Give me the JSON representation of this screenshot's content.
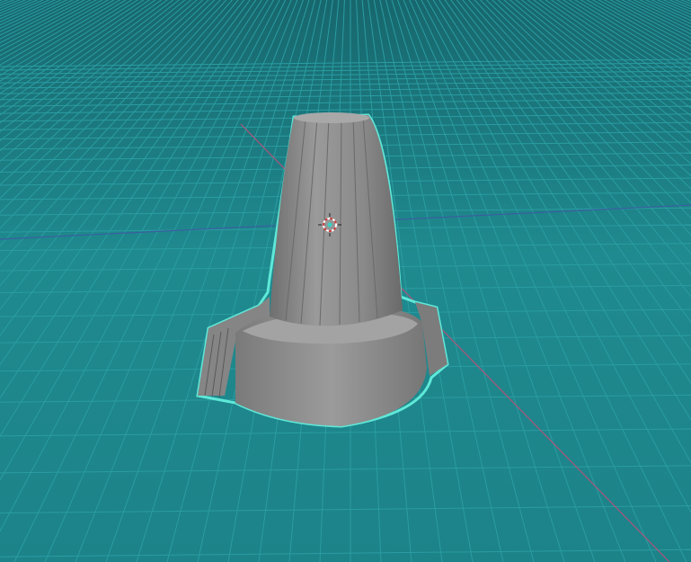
{
  "viewport": {
    "mode": "3d-viewport",
    "colors": {
      "background": "#1c8389",
      "grid": "#2a9da2",
      "x_axis": "#b0547a",
      "y_axis": "#3a5fa0",
      "object": "#8d8d8d",
      "selection_outline": "#5fe8d8"
    }
  }
}
